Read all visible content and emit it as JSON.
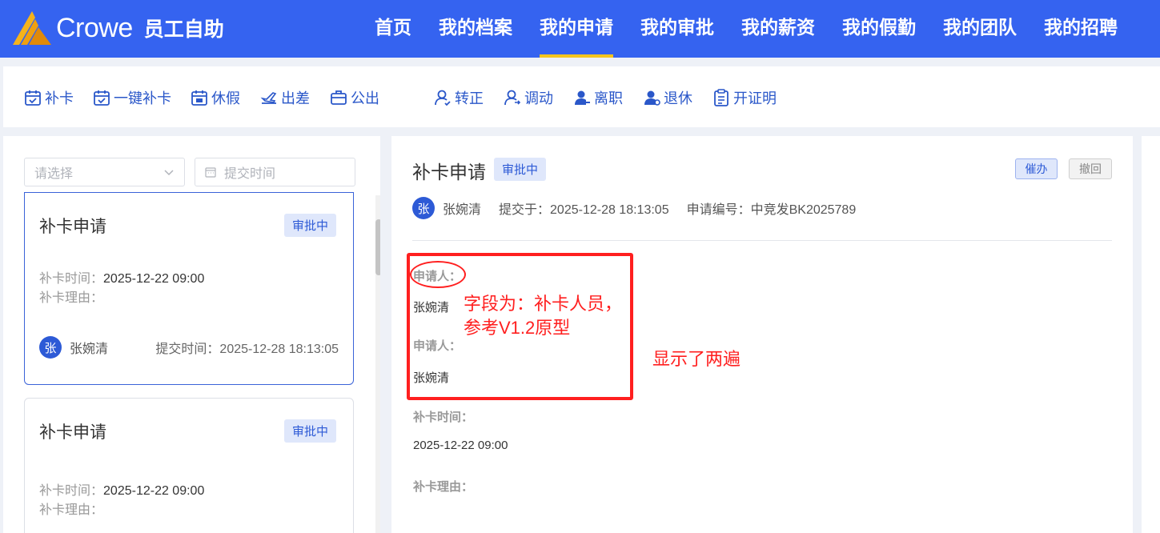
{
  "header": {
    "logo_text": "Crowe",
    "app_name": "员工自助",
    "nav": [
      {
        "label": "首页",
        "active": false
      },
      {
        "label": "我的档案",
        "active": false
      },
      {
        "label": "我的申请",
        "active": true
      },
      {
        "label": "我的审批",
        "active": false
      },
      {
        "label": "我的薪资",
        "active": false
      },
      {
        "label": "我的假勤",
        "active": false
      },
      {
        "label": "我的团队",
        "active": false
      },
      {
        "label": "我的招聘",
        "active": false
      }
    ]
  },
  "toolbar": [
    {
      "label": "补卡",
      "icon": "calendar-check-icon"
    },
    {
      "label": "一键补卡",
      "icon": "calendar-check-icon"
    },
    {
      "label": "休假",
      "icon": "calendar-leave-icon"
    },
    {
      "label": "出差",
      "icon": "plane-icon"
    },
    {
      "label": "公出",
      "icon": "briefcase-icon"
    },
    {
      "label": "转正",
      "icon": "user-check-icon"
    },
    {
      "label": "调动",
      "icon": "user-transfer-icon"
    },
    {
      "label": "离职",
      "icon": "user-leave-icon"
    },
    {
      "label": "退休",
      "icon": "user-retire-icon"
    },
    {
      "label": "开证明",
      "icon": "clipboard-icon"
    }
  ],
  "filters": {
    "select_placeholder": "请选择",
    "date_placeholder": "提交时间"
  },
  "cards": [
    {
      "title": "补卡申请",
      "status": "审批中",
      "time_label": "补卡时间：",
      "time_value": "2025-12-22 09:00",
      "reason_label": "补卡理由：",
      "avatar": "张",
      "name": "张婉清",
      "submit_label": "提交时间：",
      "submit_value": "2025-12-28 18:13:05"
    },
    {
      "title": "补卡申请",
      "status": "审批中",
      "time_label": "补卡时间：",
      "time_value": "2025-12-22 09:00",
      "reason_label": "补卡理由："
    }
  ],
  "detail": {
    "title": "补卡申请",
    "status": "审批中",
    "urge_label": "催办",
    "withdraw_label": "撤回",
    "avatar": "张",
    "name": "张婉清",
    "submitted": "提交于：2025-12-28 18:13:05",
    "app_no": "申请编号：中竞发BK2025789",
    "fields": [
      {
        "label": "申请人：",
        "value": "张婉清"
      },
      {
        "label": "申请人：",
        "value": "张婉清"
      },
      {
        "label": "补卡时间：",
        "value": "2025-12-22 09:00"
      },
      {
        "label": "补卡理由：",
        "value": ""
      }
    ]
  },
  "annotations": {
    "note1_line1": "字段为：补卡人员，",
    "note1_line2": "参考V1.2原型",
    "note2": "显示了两遍",
    "color": "#ff1f1f"
  },
  "colors": {
    "header_bg": "#3563f0",
    "nav_underline": "#f5c51c",
    "accent": "#2d5ad6"
  }
}
